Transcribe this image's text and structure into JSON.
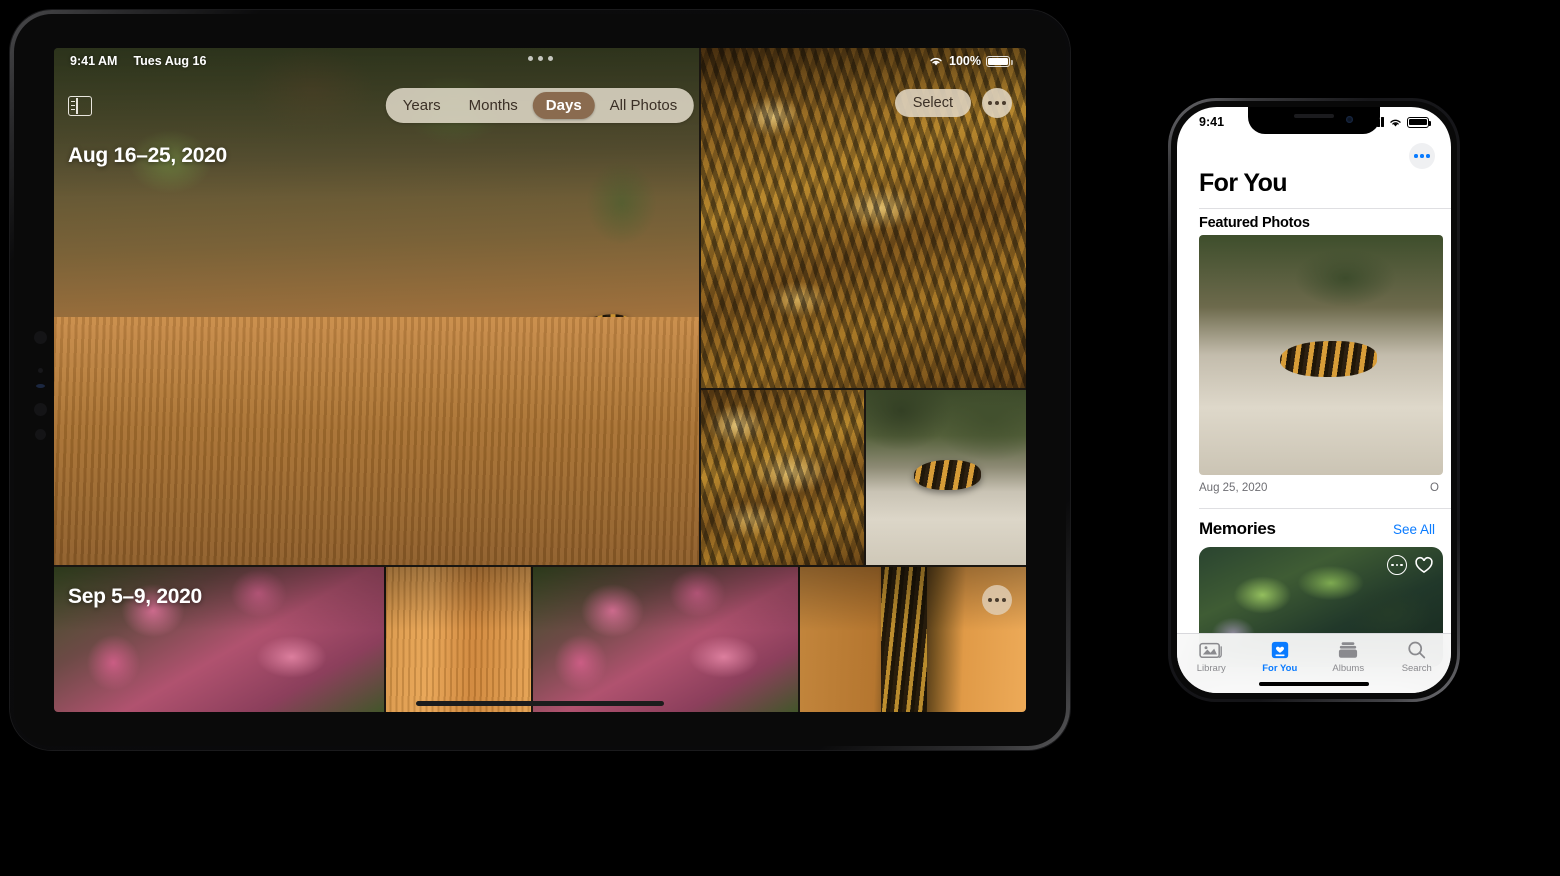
{
  "ipad": {
    "status": {
      "time": "9:41 AM",
      "date": "Tues Aug 16",
      "battery_percent": "100%",
      "wifi_icon": "wifi-icon",
      "battery_icon": "battery-icon"
    },
    "sidebar_toggle_icon": "sidebar-toggle-icon",
    "segmented_control": {
      "options": [
        {
          "label": "Years",
          "selected": false
        },
        {
          "label": "Months",
          "selected": false
        },
        {
          "label": "Days",
          "selected": true
        },
        {
          "label": "All Photos",
          "selected": false
        }
      ]
    },
    "actions": {
      "select_label": "Select",
      "more_icon": "ellipsis-icon"
    },
    "sections": [
      {
        "date_label": "Aug 16–25, 2020"
      },
      {
        "date_label": "Sep 5–9, 2020",
        "more_icon": "ellipsis-icon"
      }
    ]
  },
  "iphone": {
    "status": {
      "time": "9:41",
      "signal_icon": "cellular-signal-icon",
      "wifi_icon": "wifi-icon",
      "battery_icon": "battery-icon"
    },
    "more_icon": "ellipsis-icon",
    "title": "For You",
    "featured": {
      "heading": "Featured Photos",
      "caption_1": "Aug 25, 2020",
      "caption_2": "O"
    },
    "memories": {
      "heading": "Memories",
      "see_all": "See All",
      "more_icon": "ellipsis-icon",
      "favorite_icon": "heart-icon"
    },
    "tabs": [
      {
        "label": "Library",
        "icon": "photo-stack-icon",
        "selected": false
      },
      {
        "label": "For You",
        "icon": "for-you-card-icon",
        "selected": true
      },
      {
        "label": "Albums",
        "icon": "albums-icon",
        "selected": false
      },
      {
        "label": "Search",
        "icon": "search-icon",
        "selected": false
      }
    ]
  },
  "colors": {
    "accent_blue": "#0a7bff",
    "segment_selected": "#8a6b4f",
    "chrome_beige": "#eee6d6"
  }
}
